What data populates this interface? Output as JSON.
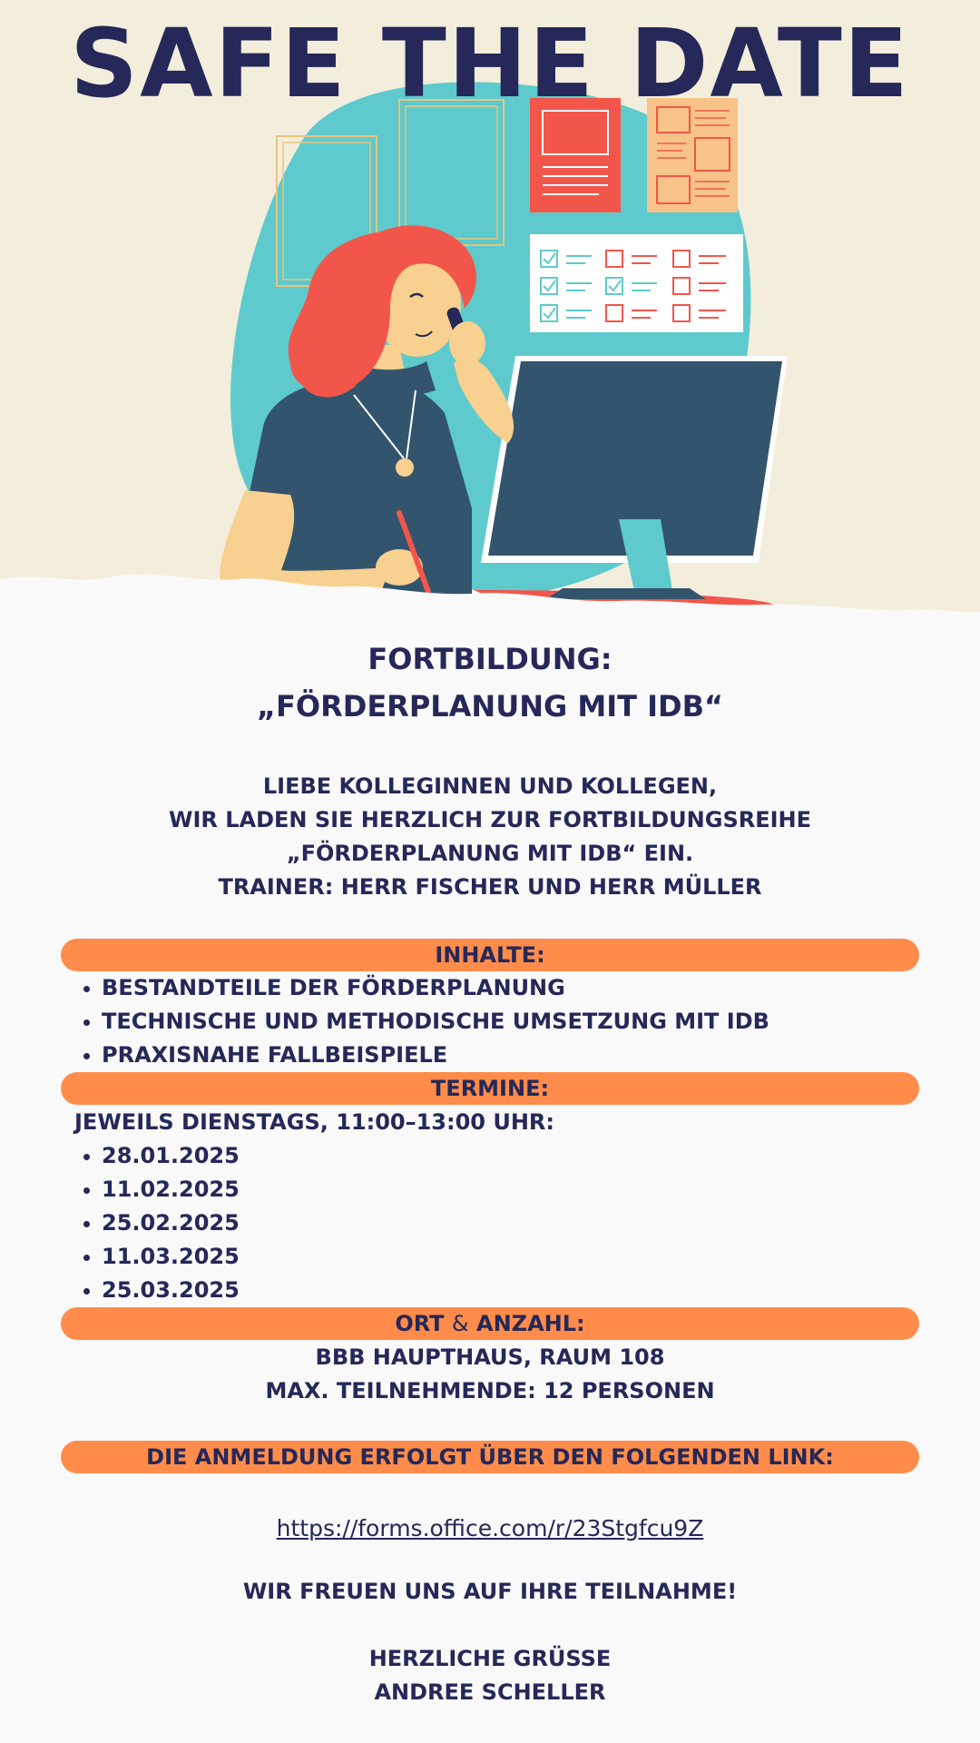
{
  "header": {
    "title": "SAFE THE DATE"
  },
  "event": {
    "line1": "FORTBILDUNG:",
    "line2": "„FÖRDERPLANUNG MIT IDB“"
  },
  "intro": {
    "line1": "LIEBE KOLLEGINNEN UND KOLLEGEN,",
    "line2": "WIR LADEN SIE HERZLICH ZUR FORTBILDUNGSREIHE",
    "line3": "„FÖRDERPLANUNG MIT IDB“ EIN.",
    "line4": "TRAINER: HERR FISCHER UND HERR MÜLLER"
  },
  "inhalte": {
    "label": "INHALTE:",
    "items": [
      "BESTANDTEILE DER FÖRDERPLANUNG",
      "TECHNISCHE UND METHODISCHE UMSETZUNG MIT IDB",
      "PRAXISNAHE FALLBEISPIELE"
    ]
  },
  "termine": {
    "label": "TERMINE:",
    "subtitle": "JEWEILS DIENSTAGS, 11:00–13:00 UHR:",
    "dates": [
      "28.01.2025",
      "11.02.2025",
      "25.02.2025",
      "11.03.2025",
      "25.03.2025"
    ]
  },
  "ort": {
    "label_a": "ORT",
    "amp": "&",
    "label_b": "ANZAHL:",
    "line1": "BBB HAUPTHAUS, RAUM 108",
    "line2": "MAX. TEILNEHMENDE: 12 PERSONEN"
  },
  "anmeldung": {
    "label": "DIE ANMELDUNG ERFOLGT ÜBER DEN FOLGENDEN LINK:",
    "link": "https://forms.office.com/r/23Stgfcu9Z"
  },
  "closing": {
    "line1": "WIR FREUEN UNS AUF IHRE TEILNAHME!",
    "greeting": "HERZLICHE GRÜSSE",
    "name": "ANDREE SCHELLER"
  },
  "colors": {
    "navy": "#252858",
    "orange_bar": "#ff8c4a",
    "cream": "#f3eddc",
    "teal": "#5ecacd",
    "red": "#f2564a",
    "skin": "#f8d08f",
    "dark_slate": "#33546d"
  }
}
